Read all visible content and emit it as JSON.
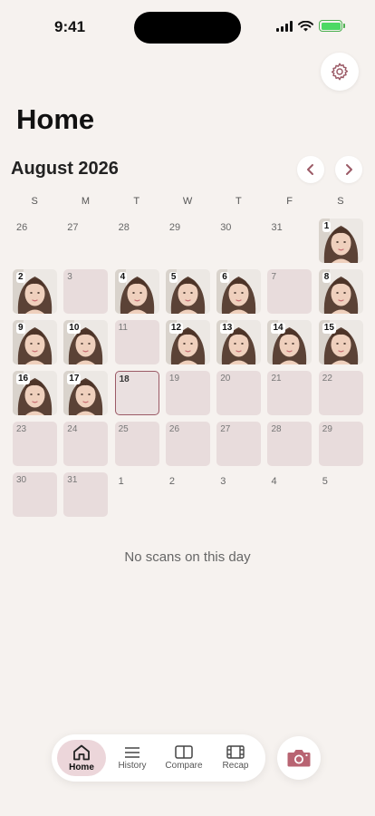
{
  "status_bar": {
    "time": "9:41",
    "battery_color": "#4cd964"
  },
  "header": {
    "title": "Home",
    "settings_icon": "gear-icon"
  },
  "calendar": {
    "month_label": "August 2026",
    "weekdays": [
      "S",
      "M",
      "T",
      "W",
      "T",
      "F",
      "S"
    ],
    "days": [
      {
        "label": "26",
        "kind": "plain"
      },
      {
        "label": "27",
        "kind": "plain"
      },
      {
        "label": "28",
        "kind": "plain"
      },
      {
        "label": "29",
        "kind": "plain"
      },
      {
        "label": "30",
        "kind": "plain"
      },
      {
        "label": "31",
        "kind": "plain"
      },
      {
        "label": "1",
        "kind": "photo"
      },
      {
        "label": "2",
        "kind": "photo"
      },
      {
        "label": "3",
        "kind": "empty"
      },
      {
        "label": "4",
        "kind": "photo"
      },
      {
        "label": "5",
        "kind": "photo"
      },
      {
        "label": "6",
        "kind": "photo"
      },
      {
        "label": "7",
        "kind": "empty"
      },
      {
        "label": "8",
        "kind": "photo"
      },
      {
        "label": "9",
        "kind": "photo"
      },
      {
        "label": "10",
        "kind": "photo"
      },
      {
        "label": "11",
        "kind": "empty"
      },
      {
        "label": "12",
        "kind": "photo"
      },
      {
        "label": "13",
        "kind": "photo"
      },
      {
        "label": "14",
        "kind": "photo"
      },
      {
        "label": "15",
        "kind": "photo"
      },
      {
        "label": "16",
        "kind": "photo"
      },
      {
        "label": "17",
        "kind": "photo"
      },
      {
        "label": "18",
        "kind": "selected"
      },
      {
        "label": "19",
        "kind": "empty"
      },
      {
        "label": "20",
        "kind": "empty"
      },
      {
        "label": "21",
        "kind": "empty"
      },
      {
        "label": "22",
        "kind": "empty"
      },
      {
        "label": "23",
        "kind": "empty"
      },
      {
        "label": "24",
        "kind": "empty"
      },
      {
        "label": "25",
        "kind": "empty"
      },
      {
        "label": "26",
        "kind": "empty"
      },
      {
        "label": "27",
        "kind": "empty"
      },
      {
        "label": "28",
        "kind": "empty"
      },
      {
        "label": "29",
        "kind": "empty"
      },
      {
        "label": "30",
        "kind": "empty"
      },
      {
        "label": "31",
        "kind": "empty"
      },
      {
        "label": "1",
        "kind": "plain"
      },
      {
        "label": "2",
        "kind": "plain"
      },
      {
        "label": "3",
        "kind": "plain"
      },
      {
        "label": "4",
        "kind": "plain"
      },
      {
        "label": "5",
        "kind": "plain"
      }
    ]
  },
  "empty_state": {
    "message": "No scans on this day"
  },
  "tab_bar": {
    "tabs": [
      {
        "label": "Home",
        "icon": "home-icon",
        "active": true
      },
      {
        "label": "History",
        "icon": "list-icon",
        "active": false
      },
      {
        "label": "Compare",
        "icon": "compare-icon",
        "active": false
      },
      {
        "label": "Recap",
        "icon": "film-icon",
        "active": false
      }
    ],
    "camera_icon": "camera-icon"
  },
  "colors": {
    "accent": "#9b5a66",
    "background": "#f6f2ef",
    "empty_cell": "#e8dcdc",
    "active_tab": "#ecd6da"
  }
}
